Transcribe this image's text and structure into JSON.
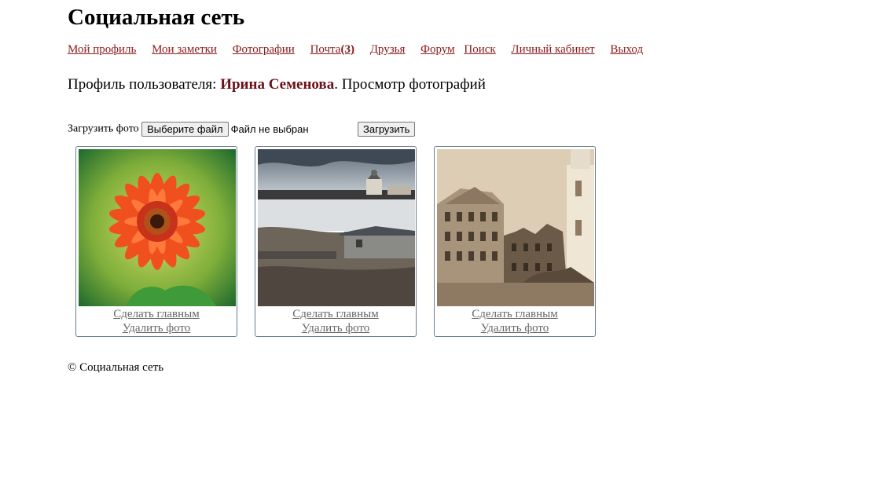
{
  "site": {
    "title": "Социальная сеть"
  },
  "nav": {
    "items": [
      {
        "label": "Мой профиль"
      },
      {
        "label": "Мои заметки"
      },
      {
        "label": "Фотографии"
      },
      {
        "label": "Почта",
        "count": "(3)"
      },
      {
        "label": "Друзья"
      },
      {
        "label": "Форум"
      },
      {
        "label": "Поиск"
      },
      {
        "label": "Личный кабинет"
      },
      {
        "label": "Выход"
      }
    ]
  },
  "profile": {
    "prefix": "Профиль пользователя: ",
    "user_name": "Ирина Семенова",
    "suffix": ". Просмотр фотографий"
  },
  "upload": {
    "label": "Загрузить фото",
    "choose_button": "Выберите файл",
    "no_file": "Файл не выбран",
    "submit_button": "Загрузить"
  },
  "photos": [
    {
      "make_main": "Сделать главным",
      "delete": "Удалить фото"
    },
    {
      "make_main": "Сделать главным",
      "delete": "Удалить фото"
    },
    {
      "make_main": "Сделать главным",
      "delete": "Удалить фото"
    }
  ],
  "footer": {
    "text": "© Социальная сеть"
  },
  "colors": {
    "link": "#8b1a1a",
    "user_name": "#6b0f1a",
    "card_border": "#6d7f91",
    "action_link": "#666666"
  }
}
